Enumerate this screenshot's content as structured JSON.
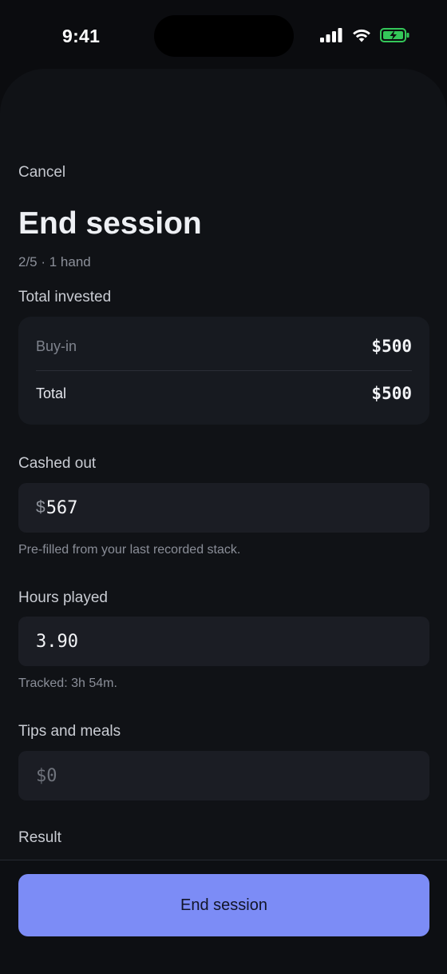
{
  "status_bar": {
    "time": "9:41"
  },
  "header": {
    "cancel_label": "Cancel",
    "title": "End session",
    "subtitle": "2/5 · 1 hand"
  },
  "total_invested": {
    "label": "Total invested",
    "rows": [
      {
        "label": "Buy-in",
        "value": "$500"
      },
      {
        "label": "Total",
        "value": "$500"
      }
    ]
  },
  "cashed_out": {
    "label": "Cashed out",
    "currency_symbol": "$",
    "value": "567",
    "hint": "Pre-filled from your last recorded stack."
  },
  "hours_played": {
    "label": "Hours played",
    "value": "3.90",
    "hint": "Tracked: 3h 54m."
  },
  "tips_and_meals": {
    "label": "Tips and meals",
    "placeholder": "$0"
  },
  "result": {
    "label": "Result"
  },
  "footer": {
    "end_session_label": "End session"
  },
  "colors": {
    "accent": "#7c8cf6",
    "background": "#0b0c0f",
    "battery": "#34c759"
  }
}
